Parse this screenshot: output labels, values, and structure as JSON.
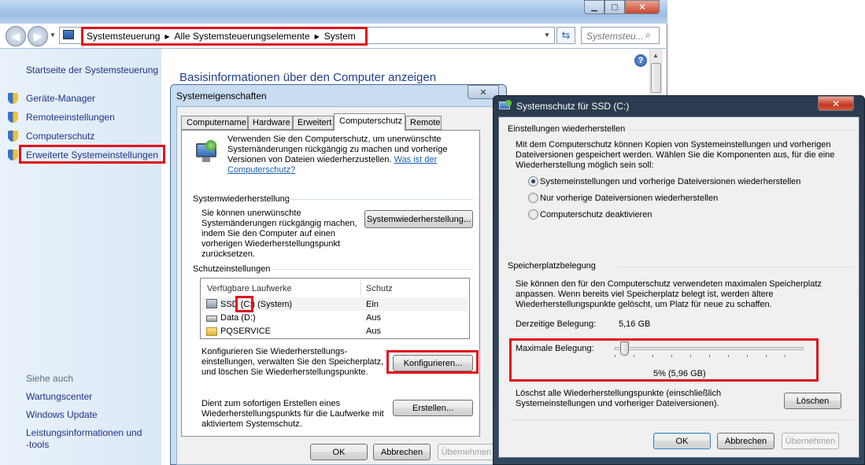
{
  "explorer": {
    "breadcrumb": [
      "Systemsteuerung",
      "Alle Systemsteuerungselemente",
      "System"
    ],
    "search_placeholder": "Systemsteu...",
    "sidebar": {
      "home": "Startseite der Systemsteuerung",
      "items": [
        "Geräte-Manager",
        "Remoteeinstellungen",
        "Computerschutz",
        "Erweiterte Systemeinstellungen"
      ],
      "see_also_title": "Siehe auch",
      "see_also": [
        "Wartungscenter",
        "Windows Update",
        "Leistungsinformationen und",
        "-tools"
      ]
    },
    "heading": "Basisinformationen über den Computer anzeigen"
  },
  "sysprops": {
    "title": "Systemeigenschaften",
    "tabs": [
      "Computername",
      "Hardware",
      "Erweitert",
      "Computerschutz",
      "Remote"
    ],
    "intro": [
      "Verwenden Sie den Computerschutz, um unerwünschte",
      "Systemänderungen rückgängig zu machen und vorherige",
      "Versionen von Dateien wiederherzustellen."
    ],
    "intro_link": [
      "Was ist der",
      "Computerschutz?"
    ],
    "restore_title": "Systemwiederherstellung",
    "restore_text": [
      "Sie können unerwünschte",
      "Systemänderungen rückgängig machen,",
      "indem Sie den Computer auf einen",
      "vorherigen Wiederherstellungspunkt",
      "zurücksetzen."
    ],
    "restore_button": "Systemwiederherstellung...",
    "protection_title": "Schutzeinstellungen",
    "col_drives": "Verfügbare Laufwerke",
    "col_protection": "Schutz",
    "drives": [
      {
        "name": "SSD",
        "letter": "(C:)",
        "suffix": "(System)",
        "status": "Ein"
      },
      {
        "name": "Data (D:)",
        "status": "Aus"
      },
      {
        "name": "PQSERVICE",
        "status": "Aus"
      }
    ],
    "configure_text": [
      "Konfigurieren Sie Wiederherstellungs-",
      "einstellungen, verwalten Sie den Speicherplatz,",
      "und löschen Sie Wiederherstellungspunkte."
    ],
    "configure_button": "Konfigurieren...",
    "create_text": [
      "Dient zum sofortigen Erstellen eines",
      "Wiederherstellungspunkts für die Laufwerke mit",
      "aktiviertem Systemschutz."
    ],
    "create_button": "Erstellen...",
    "ok": "OK",
    "cancel": "Abbrechen",
    "apply": "Übernehmen"
  },
  "protection": {
    "title": "Systemschutz für SSD (C:)",
    "restore_settings_title": "Einstellungen wiederherstellen",
    "restore_settings_text": [
      "Mit dem Computerschutz können Kopien von Systemeinstellungen und vorherigen",
      "Dateiversionen gespeichert werden. Wählen Sie die Komponenten aus, für die eine",
      "Wiederherstellung möglich sein soll:"
    ],
    "options": [
      "Systemeinstellungen und vorherige Dateiversionen wiederherstellen",
      "Nur vorherige Dateiversionen wiederherstellen",
      "Computerschutz deaktivieren"
    ],
    "selected_option": 0,
    "disk_title": "Speicherplatzbelegung",
    "disk_text": [
      "Sie können den für den Computerschutz verwendeten maximalen Speicherplatz",
      "anpassen. Wenn bereits viel Speicherplatz belegt ist, werden ältere",
      "Wiederherstellungspunkte gelöscht, um Platz für neue zu schaffen."
    ],
    "current_label": "Derzeitige Belegung:",
    "current_value": "5,16 GB",
    "max_label": "Maximale Belegung:",
    "max_percent": 5,
    "max_value": "5% (5,96 GB)",
    "delete_text": [
      "Löschst alle Wiederherstellungspunkte (einschließlich",
      "Systemeinstellungen und vorheriger Dateiversionen)."
    ],
    "delete_button": "Löschen",
    "ok": "OK",
    "cancel": "Abbrechen",
    "apply": "Übernehmen"
  }
}
